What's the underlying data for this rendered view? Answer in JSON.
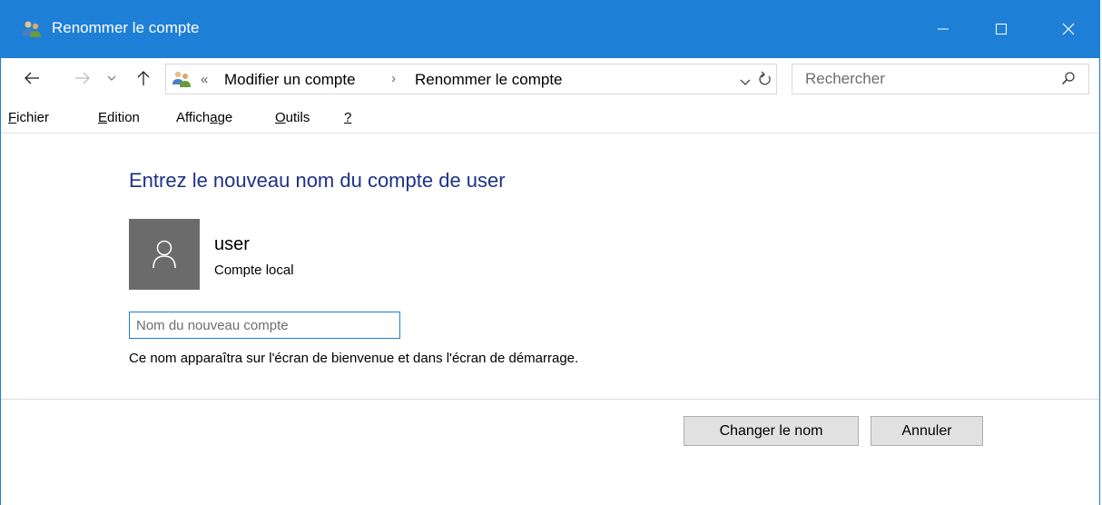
{
  "window": {
    "title": "Renommer le compte",
    "accent_color": "#1e7fd7"
  },
  "nav": {
    "back_icon": "arrow-left-icon",
    "forward_icon": "arrow-right-icon",
    "recent_icon": "chevron-down-icon",
    "up_icon": "arrow-up-icon"
  },
  "address": {
    "overflow": "«",
    "crumbs": [
      "Modifier un compte",
      "Renommer le compte"
    ],
    "separator": "›"
  },
  "search": {
    "placeholder": "Rechercher"
  },
  "menu": {
    "items": [
      {
        "mnemonic": "F",
        "rest": "ichier"
      },
      {
        "mnemonic": "E",
        "rest": "dition"
      },
      {
        "pre": "Affich",
        "mnemonic": "a",
        "rest": "ge"
      },
      {
        "mnemonic": "O",
        "rest": "utils"
      },
      {
        "mnemonic": "?",
        "rest": ""
      }
    ]
  },
  "content": {
    "heading": "Entrez le nouveau nom du compte de user",
    "heading_color": "#1e3287",
    "account_name": "user",
    "account_type": "Compte local",
    "new_name_placeholder": "Nom du nouveau compte",
    "new_name_value": "",
    "helper_text": "Ce nom apparaîtra sur l'écran de bienvenue et dans l'écran de démarrage."
  },
  "buttons": {
    "rename": "Changer le nom",
    "cancel": "Annuler"
  }
}
